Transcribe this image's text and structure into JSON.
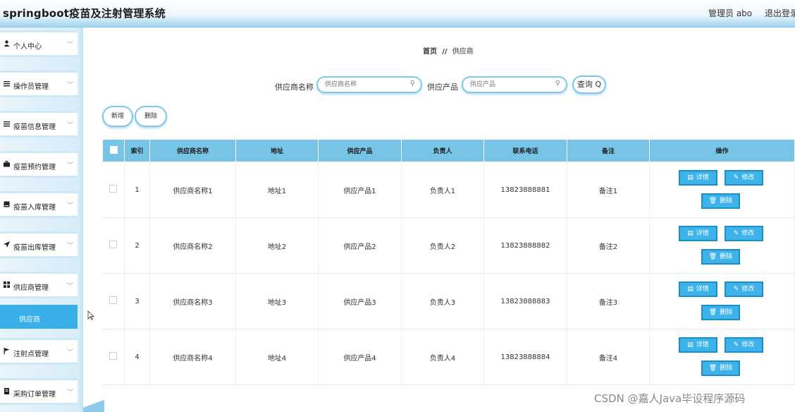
{
  "header": {
    "title": "springboot疫苗及注射管理系统",
    "user": "管理员 abo",
    "logout": "退出登录"
  },
  "sidebar": {
    "items": [
      {
        "label": "个人中心",
        "icon": "user-icon"
      },
      {
        "label": "操作员管理",
        "icon": "list-icon"
      },
      {
        "label": "疫苗信息管理",
        "icon": "list-icon"
      },
      {
        "label": "疫苗预约管理",
        "icon": "briefcase-icon"
      },
      {
        "label": "疫苗入库管理",
        "icon": "inbox-icon"
      },
      {
        "label": "疫苗出库管理",
        "icon": "send-icon"
      },
      {
        "label": "供应商管理",
        "icon": "grid-icon"
      },
      {
        "label": "注射点管理",
        "icon": "flag-icon"
      },
      {
        "label": "采购订单管理",
        "icon": "document-icon"
      }
    ],
    "active_sub": "供应商"
  },
  "breadcrumb": {
    "home": "首页",
    "sep": "//",
    "current": "供应商"
  },
  "search": {
    "name_label": "供应商名称",
    "name_placeholder": "供应商名称",
    "product_label": "供应产品",
    "product_placeholder": "供应产品",
    "query_label": "查询"
  },
  "actions": {
    "add": "新增",
    "delete": "删除"
  },
  "table": {
    "columns": [
      "索引",
      "供应商名称",
      "地址",
      "供应产品",
      "负责人",
      "联系电话",
      "备注",
      "操作"
    ],
    "rows": [
      {
        "index": "1",
        "name": "供应商名称1",
        "address": "地址1",
        "product": "供应产品1",
        "manager": "负责人1",
        "phone": "13823888881",
        "remark": "备注1"
      },
      {
        "index": "2",
        "name": "供应商名称2",
        "address": "地址2",
        "product": "供应产品2",
        "manager": "负责人2",
        "phone": "13823888882",
        "remark": "备注2"
      },
      {
        "index": "3",
        "name": "供应商名称3",
        "address": "地址3",
        "product": "供应产品3",
        "manager": "负责人3",
        "phone": "13823888883",
        "remark": "备注3"
      },
      {
        "index": "4",
        "name": "供应商名称4",
        "address": "地址4",
        "product": "供应产品4",
        "manager": "负责人4",
        "phone": "13823888884",
        "remark": "备注4"
      }
    ],
    "row_actions": {
      "detail": "详情",
      "edit": "修改",
      "delete": "删除"
    }
  },
  "watermark": "CSDN @嘉人Java毕设程序源码"
}
